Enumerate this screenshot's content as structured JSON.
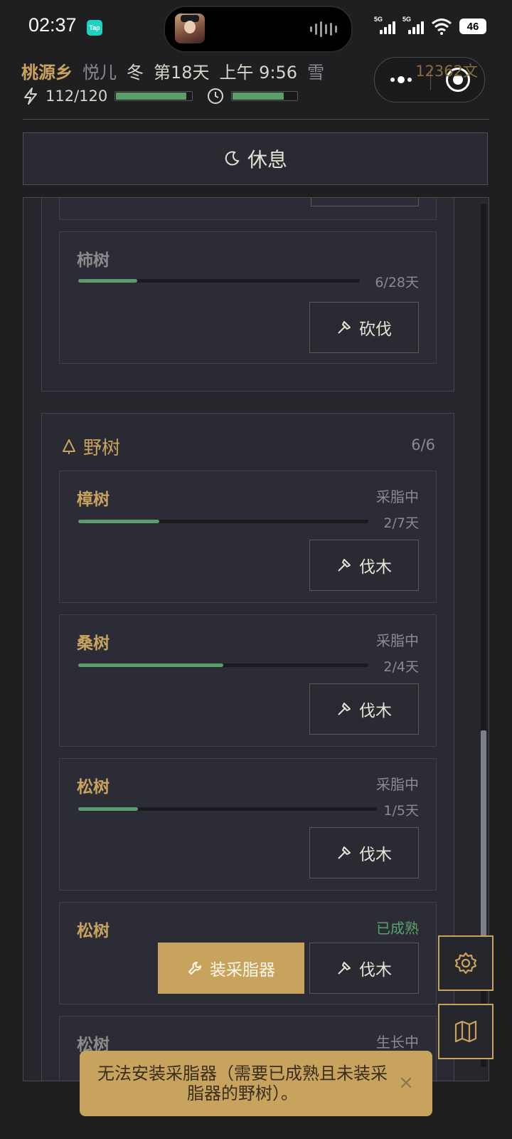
{
  "status_bar": {
    "time": "02:37",
    "tap_badge": "Tap",
    "signal1": "5G",
    "signal2": "5G",
    "battery": "46"
  },
  "header": {
    "village": "桃源乡",
    "player": "悦儿",
    "season": "冬",
    "day": "第18天",
    "clock": "上午 9:56",
    "weather": "雪",
    "stamina": "112/120",
    "stamina_fraction": 0.93,
    "time_fraction": 0.8,
    "coins": "12362文"
  },
  "rest_button": {
    "label": "休息"
  },
  "orchard_group": {
    "trees": [
      {
        "name": "柿树",
        "status": "",
        "days": "6/28天",
        "progress": 0.21,
        "action": "砍伐"
      }
    ]
  },
  "wild_group": {
    "title": "野树",
    "count": "6/6",
    "trees": [
      {
        "name": "樟树",
        "status": "采脂中",
        "days": "2/7天",
        "progress": 0.28,
        "action": "伐木"
      },
      {
        "name": "桑树",
        "status": "采脂中",
        "days": "2/4天",
        "progress": 0.5,
        "action": "伐木"
      },
      {
        "name": "松树",
        "status": "采脂中",
        "days": "1/5天",
        "progress": 0.2,
        "action": "伐木"
      },
      {
        "name": "松树",
        "status": "已成熟",
        "install_label": "装采脂器",
        "action": "伐木"
      },
      {
        "name": "松树",
        "status": "生长中"
      }
    ]
  },
  "toast": {
    "message": "无法安装采脂器（需要已成熟且未装采脂器的野树）。",
    "close": "×"
  },
  "colors": {
    "accent_gold": "#c8a35e",
    "progress_green": "#5b9d6b",
    "background": "#1f1f22"
  }
}
